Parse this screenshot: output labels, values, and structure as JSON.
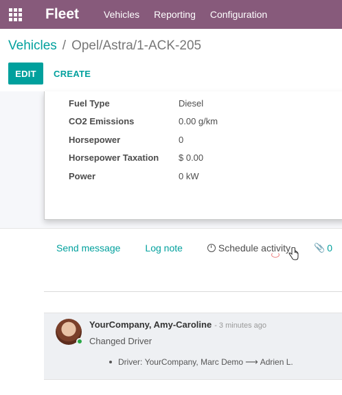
{
  "navbar": {
    "brand": "Fleet",
    "menu": [
      "Vehicles",
      "Reporting",
      "Configuration"
    ],
    "color": "#875a7b"
  },
  "breadcrumb": {
    "parent": "Vehicles",
    "separator": "/",
    "current": "Opel/Astra/1-ACK-205"
  },
  "buttons": {
    "edit": "EDIT",
    "create": "CREATE"
  },
  "fields": [
    {
      "label": "Fuel Type",
      "value": "Diesel"
    },
    {
      "label": "CO2 Emissions",
      "value": "0.00 g/km"
    },
    {
      "label": "Horsepower",
      "value": "0"
    },
    {
      "label": "Horsepower Taxation",
      "value": "$ 0.00"
    },
    {
      "label": "Power",
      "value": "0 kW"
    }
  ],
  "chatter": {
    "send_message": "Send message",
    "log_note": "Log note",
    "schedule_activity": "Schedule activity",
    "attachments_count": "0"
  },
  "message": {
    "author": "YourCompany, Amy-Caroline",
    "time": "- 3 minutes ago",
    "subtype": "Changed Driver",
    "tracking_field": "Driver:",
    "old_value": "YourCompany, Marc Demo",
    "arrow": "⟶",
    "new_value": "Adrien L."
  },
  "colors": {
    "accent": "#00a09d",
    "primary": "#875a7b",
    "online": "#28a745"
  }
}
